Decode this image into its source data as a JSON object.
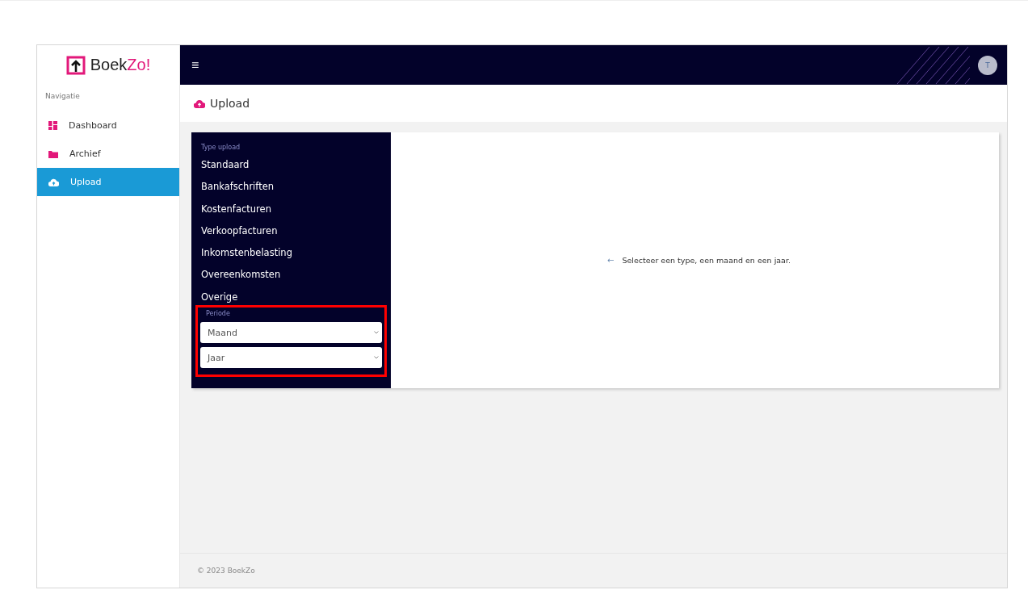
{
  "brand": {
    "name_start": "Boek",
    "name_accent": "Zo!"
  },
  "sidebar": {
    "heading": "Navigatie",
    "items": [
      {
        "label": "Dashboard",
        "kind": "dashboard",
        "selected": false
      },
      {
        "label": "Archief",
        "kind": "folder",
        "selected": false
      },
      {
        "label": "Upload",
        "kind": "cloud",
        "selected": true
      }
    ]
  },
  "topbar": {
    "menu_icon": "≡",
    "avatar": "T"
  },
  "page": {
    "title": "Upload"
  },
  "upload_types": {
    "heading": "Type upload",
    "items": [
      {
        "label": "Standaard"
      },
      {
        "label": "Bankafschriften"
      },
      {
        "label": "Kostenfacturen"
      },
      {
        "label": "Verkoopfacturen"
      },
      {
        "label": "Inkomstenbelasting"
      },
      {
        "label": "Overeenkomsten"
      },
      {
        "label": "Overige"
      }
    ]
  },
  "period": {
    "heading": "Periode",
    "highlighted": true,
    "selects": [
      {
        "placeholder": "Maand"
      },
      {
        "placeholder": "Jaar"
      }
    ]
  },
  "message": {
    "arrow": "←",
    "text": "Selecteer een type, een maand en een jaar."
  },
  "footer": "© 2023 BoekZo"
}
